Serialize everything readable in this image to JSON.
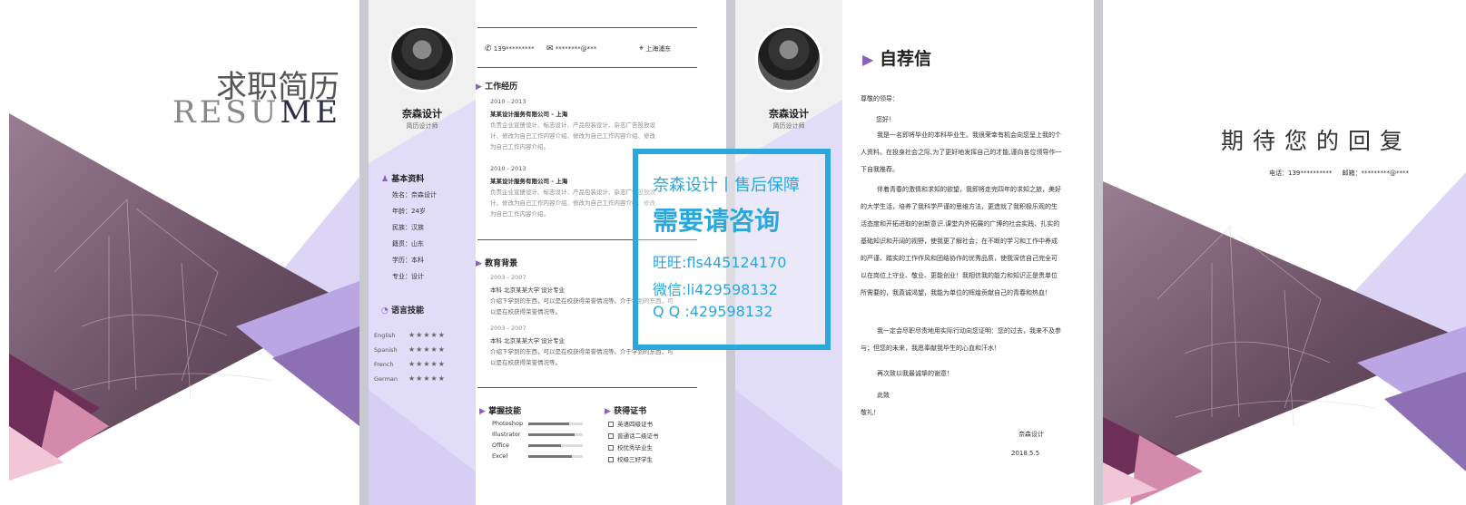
{
  "cover": {
    "title_cn": "求职简历",
    "title_en_prefix": "RESU",
    "title_en_suffix": "ME"
  },
  "resume": {
    "name": "奈森设计",
    "job_title": "简历设计师",
    "phone": "139*********",
    "email": "********@***",
    "location": "上海浦东",
    "basic_info": {
      "heading": "基本资料",
      "items": [
        "姓名：奈森设计",
        "年龄：24岁",
        "民族：汉族",
        "籍贯：山东",
        "学历：本科",
        "专业：设计"
      ]
    },
    "languages": {
      "heading": "语言技能",
      "items": [
        {
          "name": "English",
          "stars": "★★★★★"
        },
        {
          "name": "Spanish",
          "stars": "★★★★★"
        },
        {
          "name": "French",
          "stars": "★★★★★"
        },
        {
          "name": "German",
          "stars": "★★★★★"
        }
      ]
    },
    "work": {
      "heading": "工作经历",
      "entries": [
        {
          "period": "2010 - 2013",
          "company": "某某设计服务有限公司 - 上海",
          "lines": [
            "负责企业宣册设计、标志设计、产品包装设计、杂志广告投放设",
            "计、修改为自己工作内容介绍、修改为自己工作内容介绍、修改",
            "为自己工作内容介绍。"
          ]
        },
        {
          "period": "2010 - 2013",
          "company": "某某设计服务有限公司 - 上海",
          "lines": [
            "负责企业宣册设计、标志设计、产品包装设计、杂志广告投放设",
            "计、修改为自己工作内容介绍、修改为自己工作内容介绍、修改",
            "为自己工作内容介绍。"
          ]
        }
      ]
    },
    "education": {
      "heading": "教育背景",
      "entries": [
        {
          "period": "2003 - 2007",
          "school": "本科  北京某某大学  设计专业",
          "lines": [
            "介绍下学到的东西，可以是在校获得荣誉情况等。介于学到的东西，可",
            "以是在校获得荣誉情况等。"
          ]
        },
        {
          "period": "2003 - 2007",
          "school": "本科  北京某某大学  设计专业",
          "lines": [
            "介绍下学到的东西，可以是在校获得荣誉情况等。介于学到的东西，可",
            "以是在校获得荣誉情况等。"
          ]
        }
      ]
    },
    "skills": {
      "heading": "掌握技能",
      "items": [
        {
          "name": "Photoshop",
          "level": 0.75
        },
        {
          "name": "Illustrator",
          "level": 0.85
        },
        {
          "name": "Office",
          "level": 0.6
        },
        {
          "name": "Excel",
          "level": 0.8
        }
      ]
    },
    "certificates": {
      "heading": "获得证书",
      "items": [
        "英语四级证书",
        "普通话二级证书",
        "校优秀毕业生",
        "校级三好学生"
      ]
    }
  },
  "letter": {
    "name": "奈森设计",
    "job_title": "简历设计师",
    "heading": "自荐信",
    "greeting": "尊敬的领导：",
    "hello": "您好！",
    "paragraphs": [
      "我是一名即将毕业的本科毕业生。我很荣幸有机会向您呈上我的个人资料。在投身社会之际,为了更好地发挥自己的才能,谨向各位领导作一下自我推荐。",
      "伴着青春的激情和求知的欲望，我即将走完四年的求知之旅，美好的大学生活，培养了我科学严谨的思维方法，更造就了我积极乐观的生活态度和开拓进取的创新意识.课堂内外拓展的广博的社会实践、扎实的基础知识和开阔的视野，使我更了解社会；在不断的学习和工作中养成的严谨、踏实的工作作风和团结协作的优秀品质，使我深信自己完全可以在岗位上守业、敬业、更能创业！我相信我的能力和知识正是贵单位所需要的，我真诚渴望，我能为单位的辉煌贡献自己的青春和热血！",
      "我一定会尽职尽责地用实际行动向您证明：您的过去，我来不及参与；但您的未来，我愿奉献我毕生的心血和汗水！",
      "再次致以我最诚挚的谢意！"
    ],
    "closing1": "此致",
    "closing2": "敬礼！",
    "signature": "奈森设计",
    "date": "2018.5.5"
  },
  "back": {
    "slogan": "期待您的回复",
    "contact": "电话：139**********     邮箱：*********@****"
  },
  "watermark": {
    "line1": "奈森设计丨售后保障",
    "line2": "需要请咨询",
    "line3": "旺旺:fls445124170",
    "line4": "微信:li429598132",
    "line5": "Q Q :429598132"
  }
}
